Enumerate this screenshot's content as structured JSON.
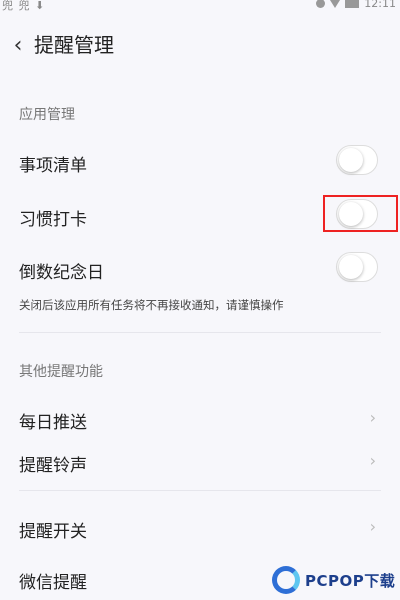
{
  "status_bar": {
    "left": "兜 兜 ⬇",
    "time": "12:11"
  },
  "header": {
    "back_icon": "chevron-left-icon",
    "title": "提醒管理"
  },
  "section_app": {
    "title": "应用管理",
    "items": [
      {
        "label": "事项清单",
        "enabled": false
      },
      {
        "label": "习惯打卡",
        "enabled": false
      },
      {
        "label": "倒数纪念日",
        "enabled": false
      }
    ],
    "note": "关闭后该应用所有任务将不再接收通知，请谨慎操作"
  },
  "section_other": {
    "title": "其他提醒功能",
    "items": [
      {
        "label": "每日推送"
      },
      {
        "label": "提醒铃声"
      },
      {
        "label": "提醒开关"
      },
      {
        "label": "微信提醒"
      }
    ]
  },
  "watermark": {
    "text": "PCPOP下载"
  },
  "colors": {
    "highlight": "#e22222",
    "watermark_blue": "#2e6fd6"
  }
}
